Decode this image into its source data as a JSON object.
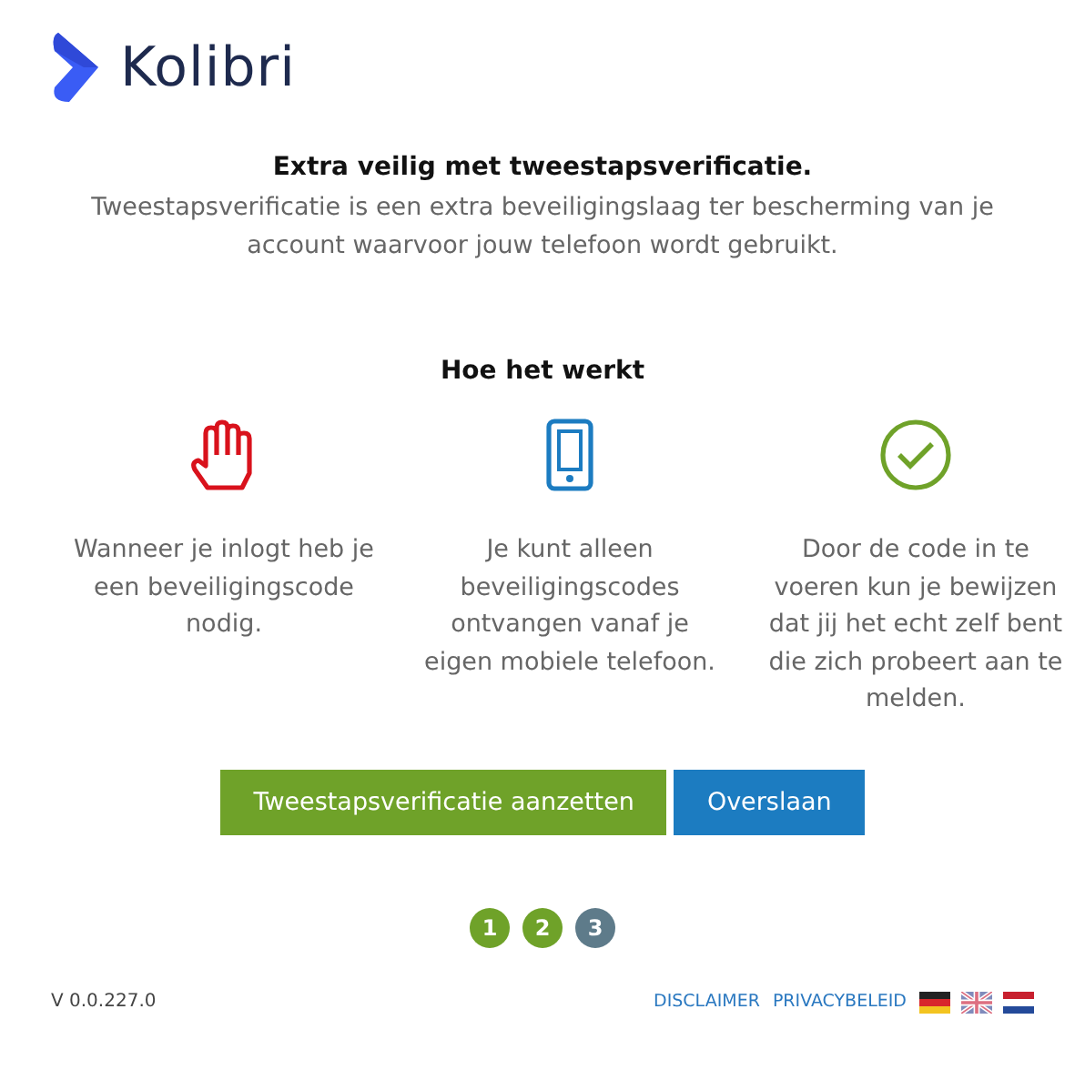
{
  "logo": {
    "name": "Kolibri"
  },
  "intro": {
    "title": "Extra veilig met tweestapsverificatie.",
    "description": "Tweestapsverificatie is een extra beveiligingslaag ter bescherming van je account waarvoor jouw telefoon wordt gebruikt."
  },
  "how_it_works": {
    "title": "Hoe het werkt",
    "steps": [
      {
        "kind": "hand",
        "text": "Wanneer je inlogt heb je een beveiligingscode nodig."
      },
      {
        "kind": "phone",
        "text": "Je kunt alleen beveiligingscodes ontvangen vanaf je eigen mobiele telefoon."
      },
      {
        "kind": "check",
        "text": "Door de code in te voeren kun je bewijzen dat jij het echt zelf bent die zich probeert aan te melden."
      }
    ]
  },
  "buttons": [
    {
      "kind": "primary",
      "label": "Tweestapsverificatie aanzetten"
    },
    {
      "kind": "secondary",
      "label": "Overslaan"
    }
  ],
  "progress": [
    {
      "label": "1",
      "done": true
    },
    {
      "label": "2",
      "done": true
    },
    {
      "label": "3",
      "done": false
    }
  ],
  "footer": {
    "version": "V 0.0.227.0",
    "links": [
      "DISCLAIMER",
      "PRIVACYBELEID"
    ],
    "languages": [
      {
        "kind": "de"
      },
      {
        "kind": "en"
      },
      {
        "kind": "nl"
      }
    ]
  }
}
